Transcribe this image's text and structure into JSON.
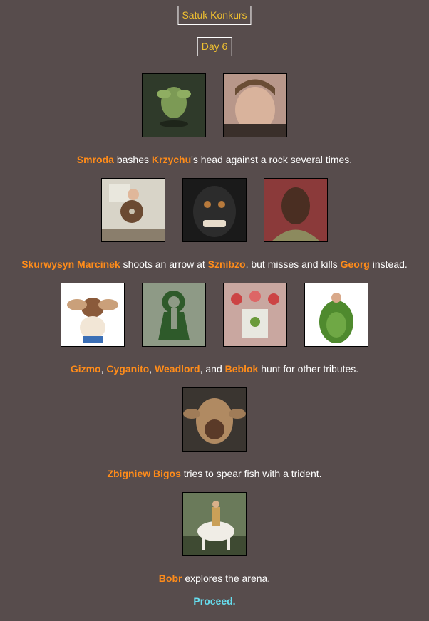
{
  "header": {
    "title": "Satuk Konkurs",
    "day": "Day 6"
  },
  "events": [
    {
      "parts": [
        {
          "t": "Smroda",
          "n": true
        },
        {
          "t": " bashes "
        },
        {
          "t": "Krzychu",
          "n": true
        },
        {
          "t": "'s head against a rock several times."
        }
      ],
      "images": [
        "yoda-like-head-photo",
        "smiling-man-photo"
      ]
    },
    {
      "parts": [
        {
          "t": "Skurwysyn Marcinek",
          "n": true
        },
        {
          "t": " shoots an arrow at "
        },
        {
          "t": "Sznibzo",
          "n": true
        },
        {
          "t": ", but misses and kills "
        },
        {
          "t": "Georg",
          "n": true
        },
        {
          "t": " instead."
        }
      ],
      "images": [
        "man-with-disk-photo",
        "monkey-selfie-photo",
        "man-with-scarf-photo"
      ]
    },
    {
      "parts": [
        {
          "t": "Gizmo",
          "n": true
        },
        {
          "t": ", "
        },
        {
          "t": "Cyganito",
          "n": true
        },
        {
          "t": ", "
        },
        {
          "t": "Weadlord",
          "n": true
        },
        {
          "t": ", and "
        },
        {
          "t": "Beblok",
          "n": true
        },
        {
          "t": " hunt for other tributes."
        }
      ],
      "images": [
        "gremlin-toy-photo",
        "keyhole-tomb-aerial-photo",
        "crowd-photo",
        "avocado-costume-photo"
      ]
    },
    {
      "parts": [
        {
          "t": "Zbigniew Bigos",
          "n": true
        },
        {
          "t": " tries to spear fish with a trident."
        }
      ],
      "images": [
        "yoda-mask-face-photo"
      ]
    },
    {
      "parts": [
        {
          "t": "Bobr",
          "n": true
        },
        {
          "t": " explores the arena."
        }
      ],
      "images": [
        "rider-on-white-horse-painting"
      ]
    }
  ],
  "footer": {
    "proceed_label": "Proceed."
  },
  "colors": {
    "background": "#574c4c",
    "name": "#ff8c1a",
    "title": "#f0c030",
    "proceed": "#66ddee"
  }
}
